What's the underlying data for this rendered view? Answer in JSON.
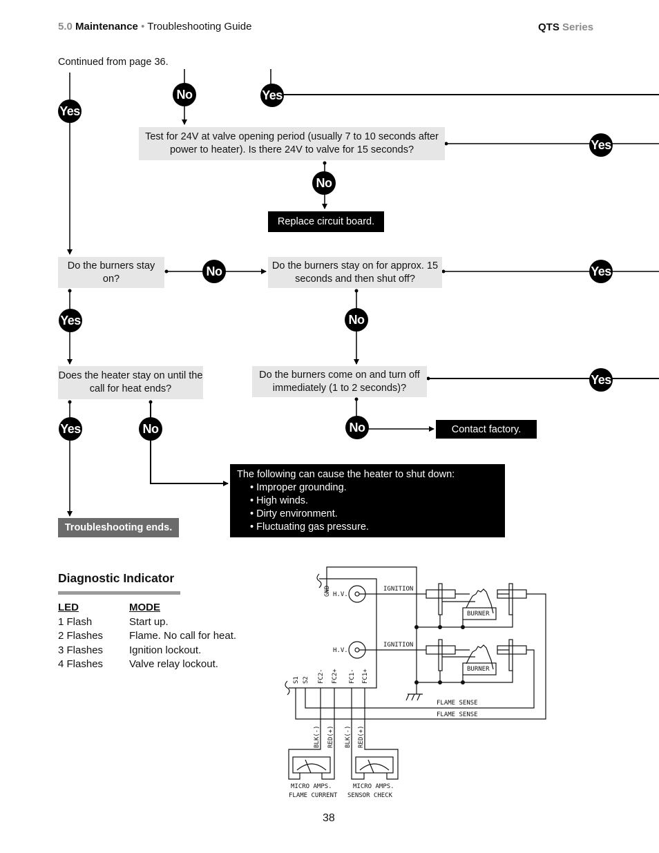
{
  "header": {
    "section_number": "5.0",
    "section_title": "Maintenance",
    "separator": "•",
    "subtitle": "Troubleshooting Guide",
    "series_brand": "QTS",
    "series_label": "Series"
  },
  "continued_note": "Continued from page 36.",
  "flowchart": {
    "badges": {
      "yes": "Yes",
      "no": "No"
    },
    "test_24v": "Test for 24V at valve opening period (usually 7 to 10 seconds after power to heater).  Is there 24V to valve for 15 seconds?",
    "replace_board": "Replace circuit board.",
    "burners_stay_on": "Do the burners stay on?",
    "burners_15s": "Do the burners stay on for approx. 15 seconds and then shut off?",
    "heater_stay_on": "Does the heater stay on until the call for heat ends?",
    "burners_immediate": "Do the burners come on and turn off immediately (1 to 2 seconds)?",
    "contact_factory": "Contact factory.",
    "troubleshooting_ends": "Troubleshooting ends.",
    "shutdown_causes": {
      "intro": "The following can cause the heater to shut down:",
      "items": [
        "Improper grounding.",
        "High winds.",
        "Dirty environment.",
        "Fluctuating gas pressure."
      ]
    }
  },
  "diagnostic": {
    "title": "Diagnostic Indicator",
    "columns": [
      "LED",
      "MODE"
    ],
    "rows": [
      {
        "led": "1 Flash",
        "mode": "Start up."
      },
      {
        "led": "2 Flashes",
        "mode": "Flame.  No call for heat."
      },
      {
        "led": "3 Flashes",
        "mode": "Ignition lockout."
      },
      {
        "led": "4 Flashes",
        "mode": "Valve relay lockout."
      }
    ]
  },
  "wiring_diagram": {
    "gnd": "GND",
    "hv": "H.V.",
    "ignition": "IGNITION",
    "burner": "BURNER",
    "flame_sense": "FLAME SENSE",
    "terminals": [
      "S1",
      "S2",
      "FC2-",
      "FC2+",
      "FC1-",
      "FC1+"
    ],
    "blk": "BLK(-)",
    "red": "RED(+)",
    "meter1_line1": "MICRO  AMPS.",
    "meter1_line2": "FLAME  CURRENT",
    "meter2_line1": "MICRO  AMPS.",
    "meter2_line2": "SENSOR  CHECK"
  },
  "page_number": "38"
}
